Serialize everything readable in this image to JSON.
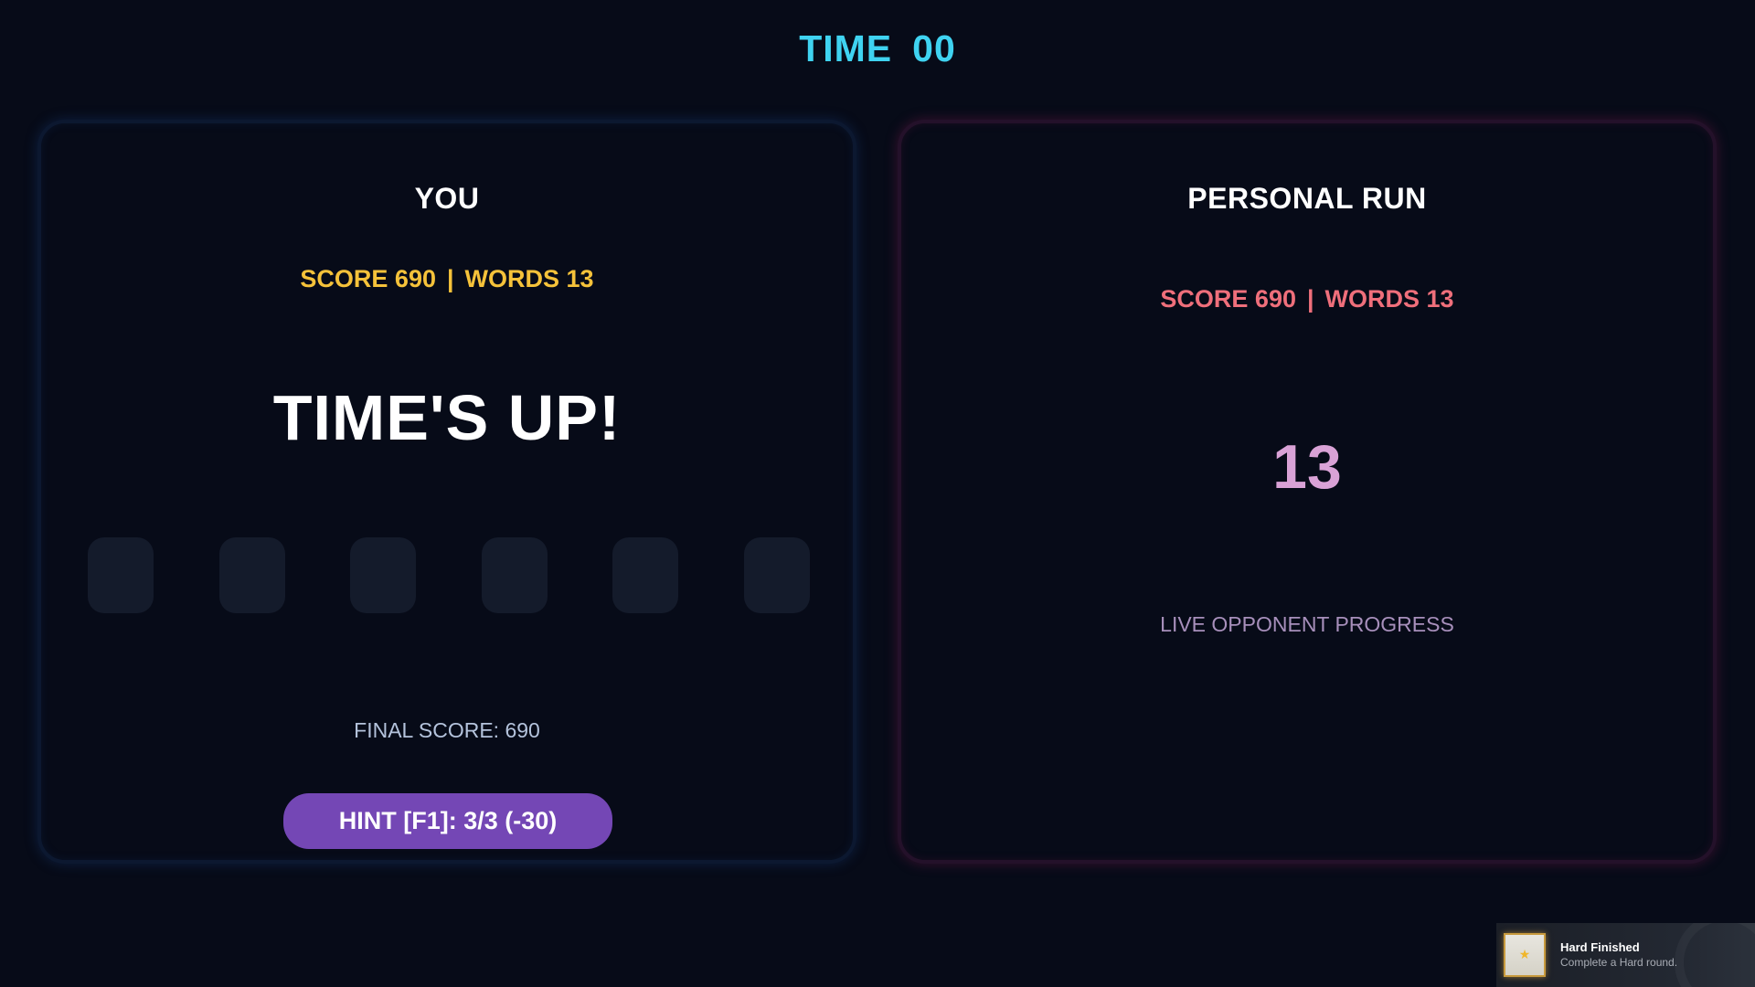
{
  "timer": {
    "label": "TIME",
    "value": "00"
  },
  "player_panel": {
    "title": "YOU",
    "score_label": "SCORE 690",
    "separator": "|",
    "words_label": "WORDS 13",
    "status": "TIME'S UP!",
    "letter_slot_count": 6,
    "final_score": "FINAL SCORE: 690",
    "hint_button": "HINT [F1]: 3/3  (-30)"
  },
  "opponent_panel": {
    "title": "PERSONAL RUN",
    "score_label": "SCORE 690",
    "separator": "|",
    "words_label": "WORDS 13",
    "word_count": "13",
    "caption": "LIVE OPPONENT PROGRESS"
  },
  "achievement_toast": {
    "title": "Hard Finished",
    "description": "Complete a Hard round.",
    "icon": "star-icon"
  },
  "colors": {
    "background": "#070b18",
    "timer": "#3fd3f1",
    "player_score": "#f5c23a",
    "opponent_score": "#ef6f7b",
    "opponent_count": "#d9a2d6",
    "hint_button": "#7447b5"
  }
}
